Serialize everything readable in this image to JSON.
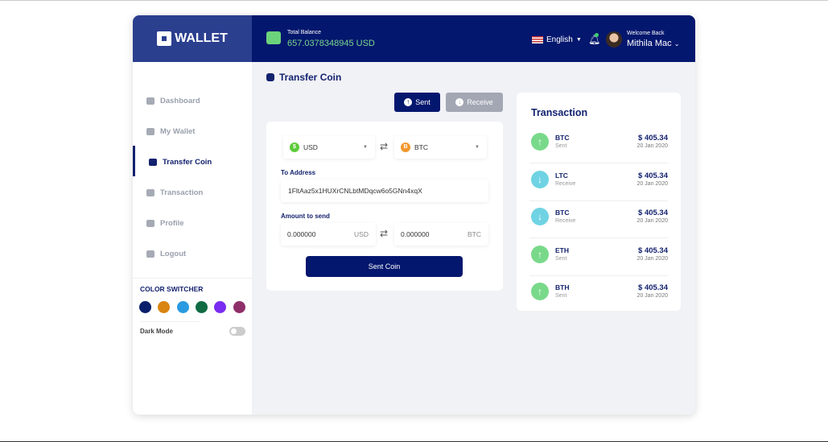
{
  "app": {
    "logo": "WALLET"
  },
  "header": {
    "balance_label": "Total Balance",
    "balance_value": "657.0378348945 USD",
    "language": "English",
    "welcome": "Welcome Back",
    "user": "Mithila Mac"
  },
  "sidebar": {
    "items": [
      {
        "label": "Dashboard",
        "icon": "dashboard-icon"
      },
      {
        "label": "My Wallet",
        "icon": "wallet-icon"
      },
      {
        "label": "Transfer Coin",
        "icon": "coins-icon",
        "active": true
      },
      {
        "label": "Transaction",
        "icon": "history-icon"
      },
      {
        "label": "Profile",
        "icon": "user-icon"
      },
      {
        "label": "Logout",
        "icon": "logout-icon"
      }
    ],
    "color_switcher_label": "COLOR SWITCHER",
    "colors": [
      "#0a1f6b",
      "#d98512",
      "#2a9be0",
      "#116b43",
      "#7a2cf0",
      "#8f2f6a"
    ],
    "dark_mode_label": "Dark Mode",
    "dark_mode_on": false
  },
  "main": {
    "title": "Transfer Coin",
    "sent_label": "Sent",
    "receive_label": "Receive",
    "form": {
      "from_currency": "USD",
      "to_currency": "BTC",
      "to_address_label": "To Address",
      "to_address": "1FltAaz5x1HUXrCNLbtMDqcw6o5GNn4xqX",
      "amount_label": "Amount to send",
      "amount_from": "0.000000",
      "amount_from_unit": "USD",
      "amount_to": "0.000000",
      "amount_to_unit": "BTC",
      "submit": "Sent Coin"
    }
  },
  "transactions": {
    "title": "Transaction",
    "items": [
      {
        "coin": "BTC",
        "type": "Sent",
        "amount": "$ 405.34",
        "date": "20 Jan 2020"
      },
      {
        "coin": "LTC",
        "type": "Receive",
        "amount": "$ 405.34",
        "date": "20 Jan 2020"
      },
      {
        "coin": "BTC",
        "type": "Receive",
        "amount": "$ 405.34",
        "date": "20 Jan 2020"
      },
      {
        "coin": "ETH",
        "type": "Sent",
        "amount": "$ 405.34",
        "date": "20 Jan 2020"
      },
      {
        "coin": "BTH",
        "type": "Sent",
        "amount": "$ 405.34",
        "date": "20 Jan 2020"
      }
    ]
  },
  "colors": {
    "primary": "#04176e",
    "sent": "#79d98a",
    "receive": "#6fd3e3"
  }
}
